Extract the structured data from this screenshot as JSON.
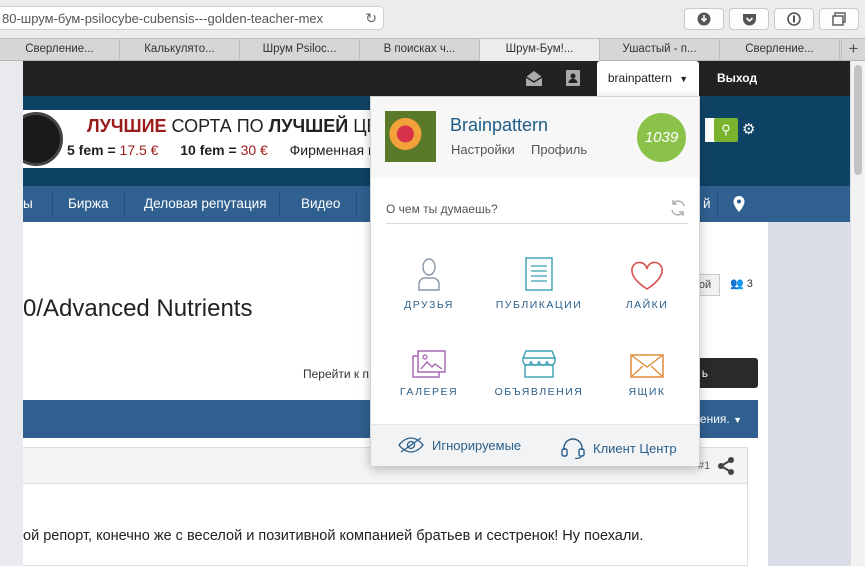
{
  "browser": {
    "url": "80-шрум-бум-psilocybe-cubensis---golden-teacher-mex",
    "tabs": [
      {
        "label": "Сверление..."
      },
      {
        "label": "Калькулято..."
      },
      {
        "label": "Шрум Psiloc..."
      },
      {
        "label": "В поисках ч..."
      },
      {
        "label": "Шрум-Бум!..."
      },
      {
        "label": "Ушастый - п..."
      },
      {
        "label": "Сверление..."
      }
    ],
    "new_tab": "+"
  },
  "topbar": {
    "username": "brainpattern",
    "logout": "Выход"
  },
  "banner": {
    "line1_part1": "ЛУЧШИЕ",
    "line1_part2": " СОРТА ПО ",
    "line1_part3": "ЛУЧШЕЙ",
    "line1_part4": " ЦЕН",
    "line2_a": "5 fem = ",
    "line2_b": "17.5 €",
    "line2_c": "10 fem = ",
    "line2_d": "30 €",
    "line2_e": "Фирменная н"
  },
  "nav": {
    "items": [
      {
        "label": "ы"
      },
      {
        "label": "Биржа"
      },
      {
        "label": "Деловая репутация"
      },
      {
        "label": "Видео"
      },
      {
        "label": "й"
      }
    ]
  },
  "content": {
    "title": "0/Advanced Nutrients",
    "follow_label": "ой",
    "follow_count": "3",
    "goto_label": "Перейти к п",
    "dark_button_tail": "ь",
    "bar_text": "ления.",
    "post_number": "#1",
    "post_text": "ой репорт, конечно же с веселой и позитивной компанией братьев и сестренок! Ну поехали."
  },
  "dropdown": {
    "name": "Brainpattern",
    "settings": "Настройки",
    "profile": "Профиль",
    "reputation": "1039",
    "status_placeholder": "О чем ты думаешь?",
    "grid": [
      {
        "label": "ДРУЗЬЯ",
        "icon": "person-icon"
      },
      {
        "label": "ПУБЛИКАЦИИ",
        "icon": "document-icon"
      },
      {
        "label": "ЛАЙКИ",
        "icon": "heart-icon"
      },
      {
        "label": "ГАЛЕРЕЯ",
        "icon": "gallery-icon"
      },
      {
        "label": "ОБЪЯВЛЕНИЯ",
        "icon": "store-icon"
      },
      {
        "label": "ЯЩИК",
        "icon": "mail-icon"
      }
    ],
    "footer": {
      "ignored": "Игнорируемые",
      "client_center": "Клиент Центр"
    }
  },
  "colors": {
    "nav_blue": "#2f6090",
    "banner_navy": "#0f4365",
    "accent_green": "#8bc34a",
    "heart_red": "#d94f4f",
    "mail_orange": "#e08a3c",
    "link_blue": "#2a5f8a"
  }
}
